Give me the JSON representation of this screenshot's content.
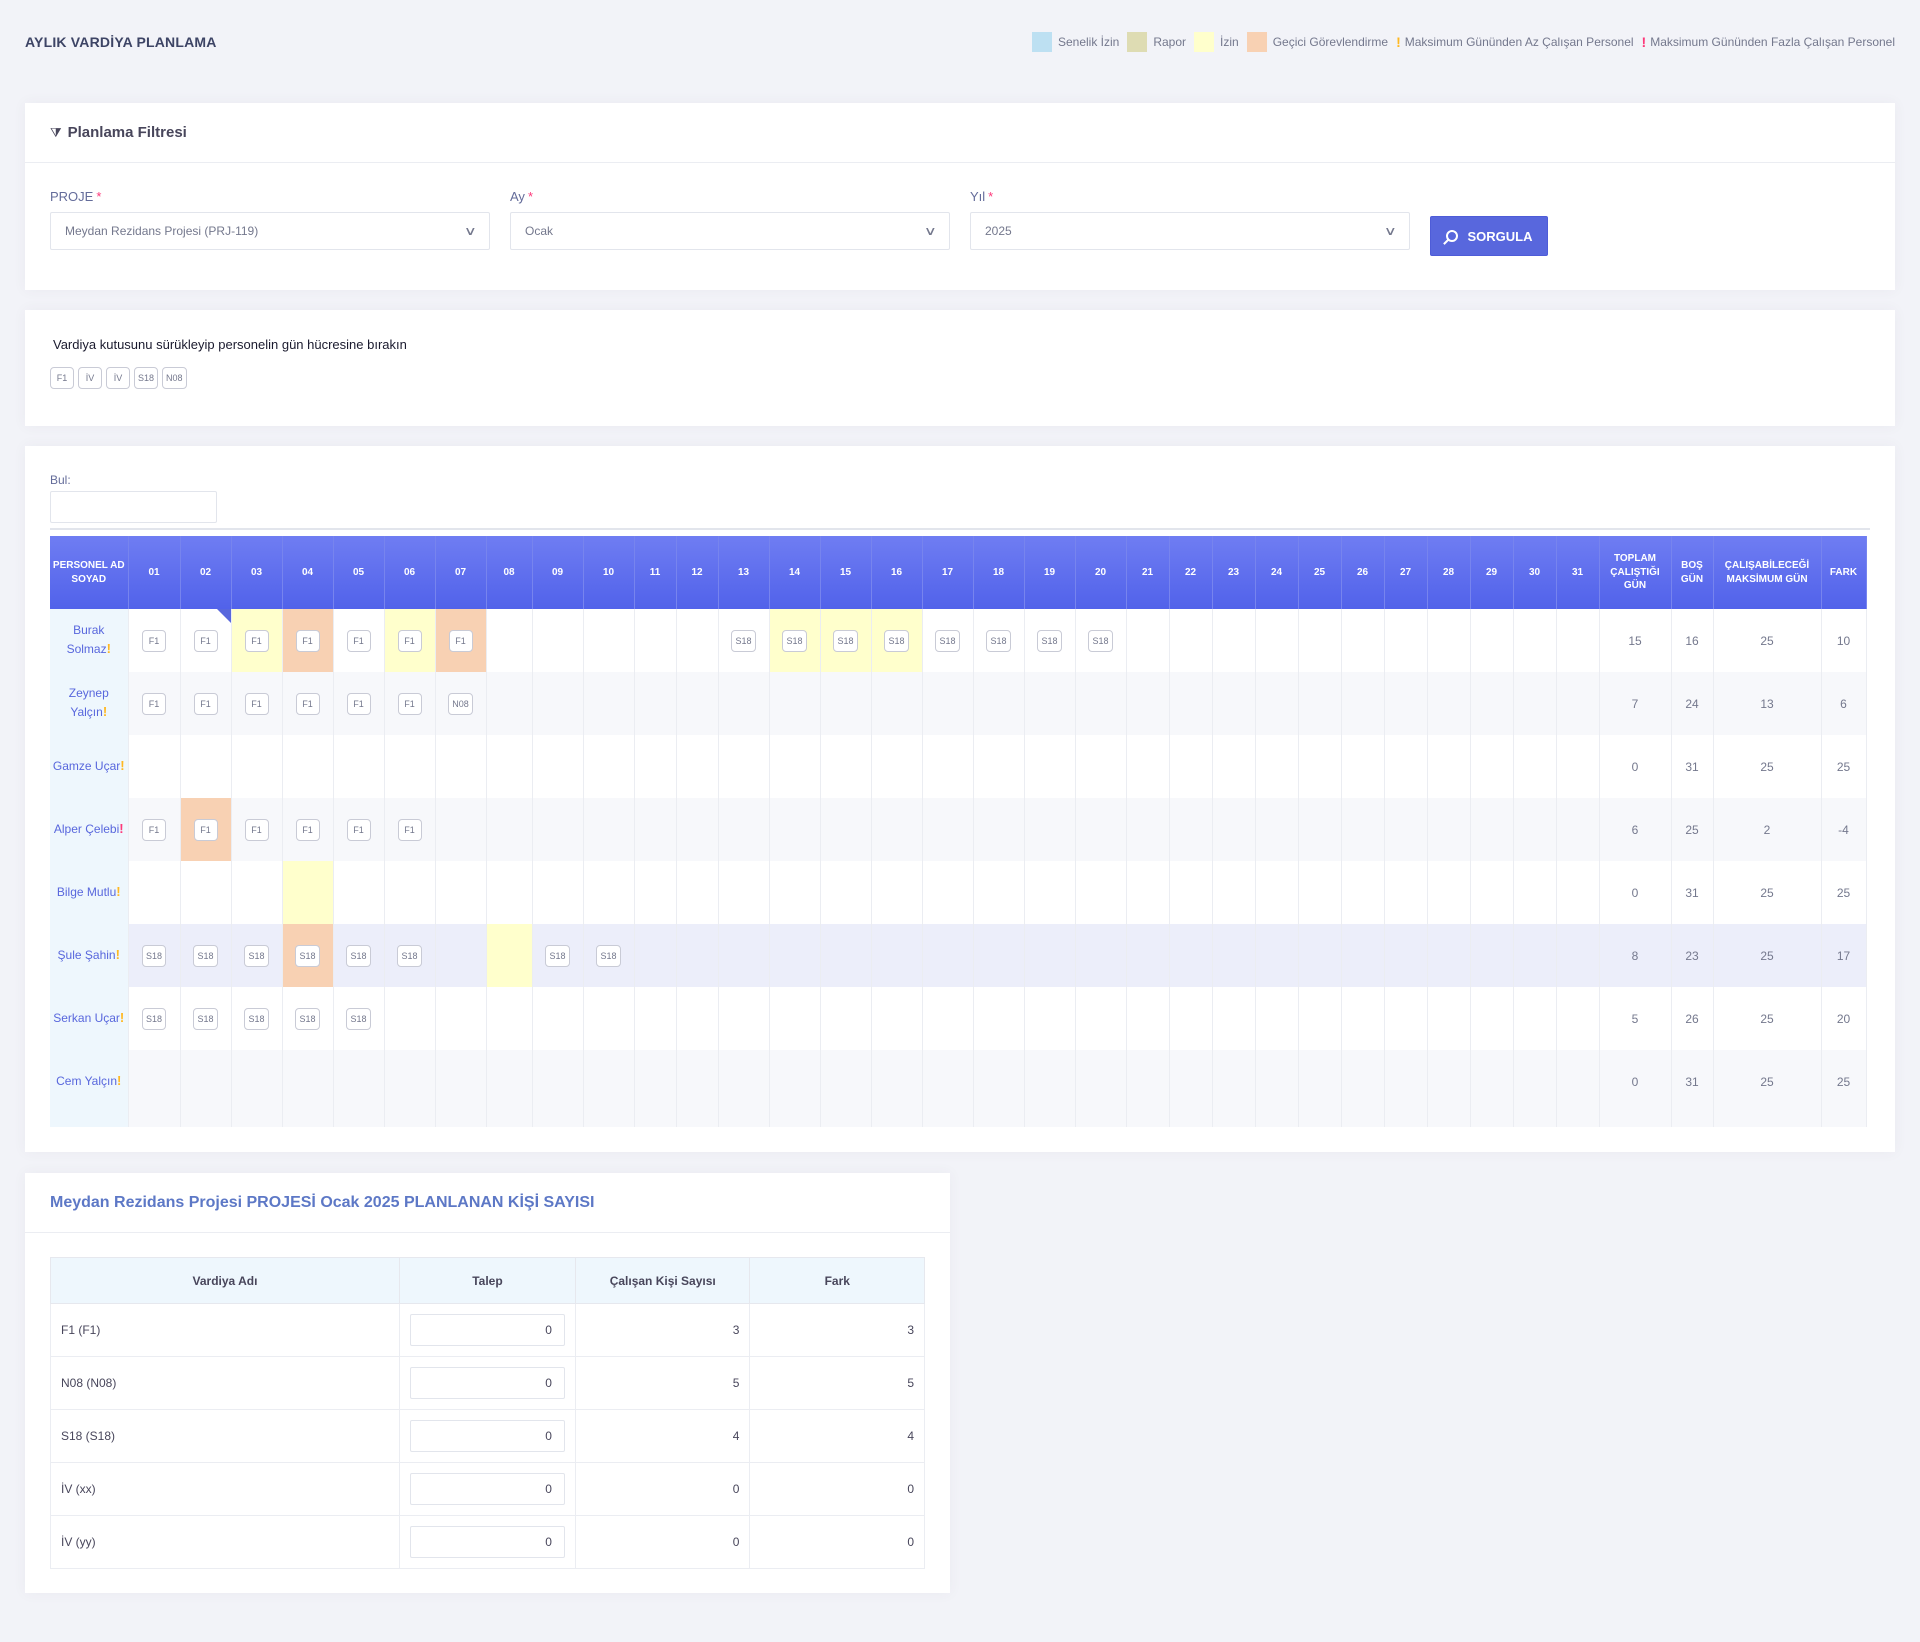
{
  "page": {
    "title": "AYLIK VARDİYA PLANLAMA"
  },
  "legend": [
    {
      "kind": "swatch",
      "label": "Senelik İzin",
      "color": "#bde0f2"
    },
    {
      "kind": "swatch",
      "label": "Rapor",
      "color": "#dedcb3"
    },
    {
      "kind": "swatch",
      "label": "İzin",
      "color": "#ffffcc"
    },
    {
      "kind": "swatch",
      "label": "Geçici Görevlendirme",
      "color": "#f8d1b3"
    },
    {
      "kind": "mark",
      "label": "Maksimum Gününden Az Çalışan Personel",
      "color": "#ffb822"
    },
    {
      "kind": "mark",
      "label": "Maksimum Gününden Fazla Çalışan Personel",
      "color": "#fd397a"
    }
  ],
  "filter": {
    "title": "Planlama Filtresi",
    "project_label": "PROJE",
    "project_value": "Meydan Rezidans Projesi (PRJ-119)",
    "month_label": "Ay",
    "month_value": "Ocak",
    "year_label": "Yıl",
    "year_value": "2025",
    "required_mark": "*",
    "query_button": "SORGULA"
  },
  "drag": {
    "hint": "Vardiya kutusunu sürükleyip personelin gün hücresine bırakın",
    "shifts": [
      "F1",
      "İV",
      "İV",
      "S18",
      "N08"
    ]
  },
  "schedule": {
    "find_label": "Bul:",
    "find_value": "",
    "headers": {
      "name": "PERSONEL AD SOYAD",
      "days": [
        "01",
        "02",
        "03",
        "04",
        "05",
        "06",
        "07",
        "08",
        "09",
        "10",
        "11",
        "12",
        "13",
        "14",
        "15",
        "16",
        "17",
        "18",
        "19",
        "20",
        "21",
        "22",
        "23",
        "24",
        "25",
        "26",
        "27",
        "28",
        "29",
        "30",
        "31"
      ],
      "total": "TOPLAM ÇALIŞTIĞI GÜN",
      "empty": "BOŞ GÜN",
      "max": "ÇALIŞABİLECEĞİ MAKSİMUM GÜN",
      "diff": "FARK"
    },
    "rows": [
      {
        "name": "Burak Solmaz",
        "warn": "under",
        "cells": {
          "1": "F1",
          "2": "F1",
          "3": "F1",
          "4": "F1",
          "5": "F1",
          "6": "F1",
          "7": "F1",
          "13": "S18",
          "14": "S18",
          "15": "S18",
          "16": "S18",
          "17": "S18",
          "18": "S18",
          "19": "S18",
          "20": "S18"
        },
        "marks": {
          "3": "izin",
          "4": "gecici",
          "6": "izin",
          "7": "gecici",
          "14": "izin",
          "15": "izin",
          "16": "izin"
        },
        "corner": "2",
        "total": "15",
        "empty": "16",
        "max": "25",
        "diff": "10"
      },
      {
        "name": "Zeynep Yalçın",
        "warn": "under",
        "cells": {
          "1": "F1",
          "2": "F1",
          "3": "F1",
          "4": "F1",
          "5": "F1",
          "6": "F1",
          "7": "N08"
        },
        "marks": {},
        "total": "7",
        "empty": "24",
        "max": "13",
        "diff": "6"
      },
      {
        "name": "Gamze Uçar",
        "warn": "under",
        "cells": {},
        "marks": {},
        "total": "0",
        "empty": "31",
        "max": "25",
        "diff": "25"
      },
      {
        "name": "Alper Çelebi",
        "warn": "over",
        "cells": {
          "1": "F1",
          "2": "F1",
          "3": "F1",
          "4": "F1",
          "5": "F1",
          "6": "F1"
        },
        "marks": {
          "2": "gecici"
        },
        "total": "6",
        "empty": "25",
        "max": "2",
        "diff": "-4"
      },
      {
        "name": "Bilge Mutlu",
        "warn": "under",
        "cells": {},
        "marks": {
          "4": "izin"
        },
        "total": "0",
        "empty": "31",
        "max": "25",
        "diff": "25"
      },
      {
        "name": "Şule Şahin",
        "warn": "under",
        "cells": {
          "1": "S18",
          "2": "S18",
          "3": "S18",
          "4": "S18",
          "5": "S18",
          "6": "S18",
          "9": "S18",
          "10": "S18"
        },
        "marks": {
          "4": "gecici",
          "8": "izin"
        },
        "total": "8",
        "empty": "23",
        "max": "25",
        "diff": "17"
      },
      {
        "name": "Serkan Uçar",
        "warn": "under",
        "cells": {
          "1": "S18",
          "2": "S18",
          "3": "S18",
          "4": "S18",
          "5": "S18"
        },
        "marks": {},
        "total": "5",
        "empty": "26",
        "max": "25",
        "diff": "20"
      },
      {
        "name": "Cem Yalçın",
        "warn": "under",
        "cells": {},
        "marks": {},
        "total": "0",
        "empty": "31",
        "max": "25",
        "diff": "25"
      }
    ]
  },
  "summary": {
    "title": "Meydan Rezidans Projesi PROJESİ Ocak 2025 PLANLANAN KİŞİ SAYISI",
    "headers": [
      "Vardiya Adı",
      "Talep",
      "Çalışan Kişi Sayısı",
      "Fark"
    ],
    "rows": [
      {
        "name": "F1 (F1)",
        "talep": "0",
        "count": "3",
        "diff": "3"
      },
      {
        "name": "N08 (N08)",
        "talep": "0",
        "count": "5",
        "diff": "5"
      },
      {
        "name": "S18 (S18)",
        "talep": "0",
        "count": "4",
        "diff": "4"
      },
      {
        "name": "İV (xx)",
        "talep": "0",
        "count": "0",
        "diff": "0"
      },
      {
        "name": "İV (yy)",
        "talep": "0",
        "count": "0",
        "diff": "0"
      }
    ]
  }
}
